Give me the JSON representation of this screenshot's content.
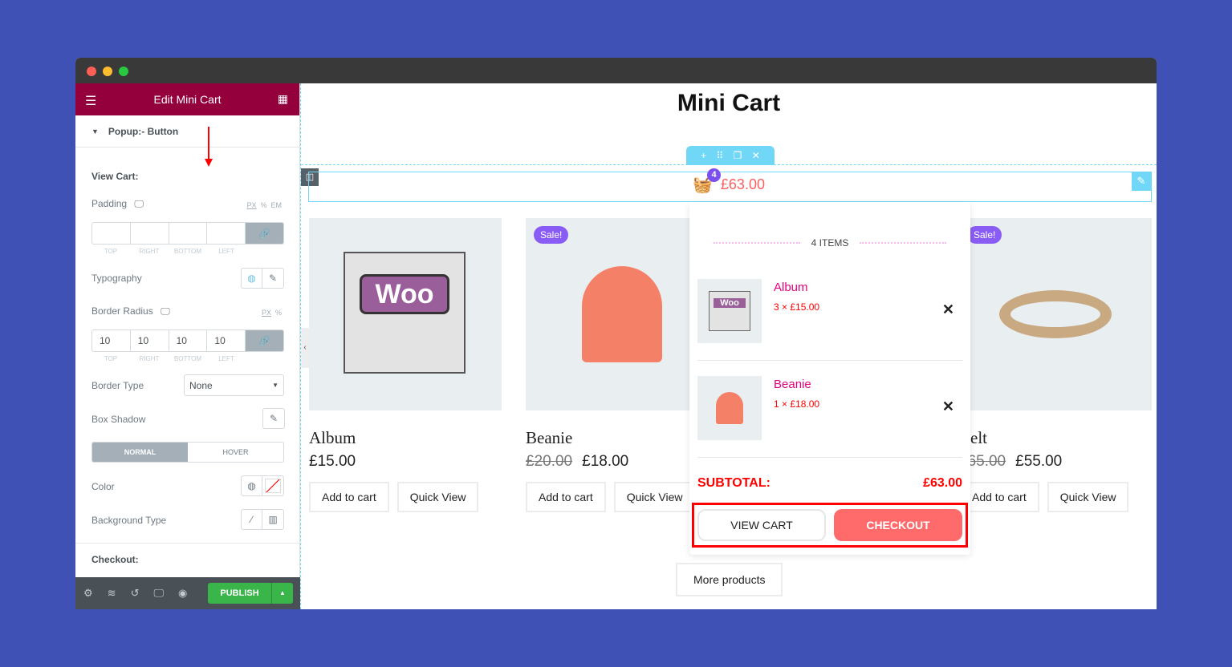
{
  "window": {
    "colors": {
      "close": "#ff5f57",
      "min": "#febc2e",
      "max": "#28c840"
    }
  },
  "sidebar": {
    "title": "Edit Mini Cart",
    "section": "Popup:- Button",
    "view_cart": "View Cart:",
    "padding": "Padding",
    "units_px": "PX",
    "units_pct": "%",
    "units_em": "EM",
    "sides": [
      "TOP",
      "RIGHT",
      "BOTTOM",
      "LEFT"
    ],
    "padding_values": [
      "",
      "",
      "",
      ""
    ],
    "typography": "Typography",
    "border_radius": "Border Radius",
    "radius_values": [
      "10",
      "10",
      "10",
      "10"
    ],
    "border_type": "Border Type",
    "border_type_value": "None",
    "box_shadow": "Box Shadow",
    "tab_normal": "NORMAL",
    "tab_hover": "HOVER",
    "color": "Color",
    "background_type": "Background Type",
    "checkout": "Checkout:",
    "publish": "PUBLISH"
  },
  "page": {
    "title": "Mini Cart",
    "cart_count": "4",
    "cart_total": "£63.00"
  },
  "products": [
    {
      "name": "Album",
      "price": "£15.00",
      "old_price": "",
      "sale": "",
      "add": "Add to cart",
      "quick": "Quick View"
    },
    {
      "name": "Beanie",
      "price": "£18.00",
      "old_price": "£20.00",
      "sale": "Sale!",
      "add": "Add to cart",
      "quick": "Quick View"
    },
    {
      "name": "Belt",
      "price": "£55.00",
      "old_price": "£65.00",
      "sale": "Sale!",
      "add": "Add to cart",
      "quick": "Quick View"
    }
  ],
  "more_products": "More products",
  "popup": {
    "items_label": "4 ITEMS",
    "items": [
      {
        "name": "Album",
        "qty": "3 × £15.00"
      },
      {
        "name": "Beanie",
        "qty": "1 × £18.00"
      }
    ],
    "subtotal_label": "SUBTOTAL:",
    "subtotal": "£63.00",
    "view_cart": "VIEW CART",
    "checkout": "CHECKOUT"
  }
}
